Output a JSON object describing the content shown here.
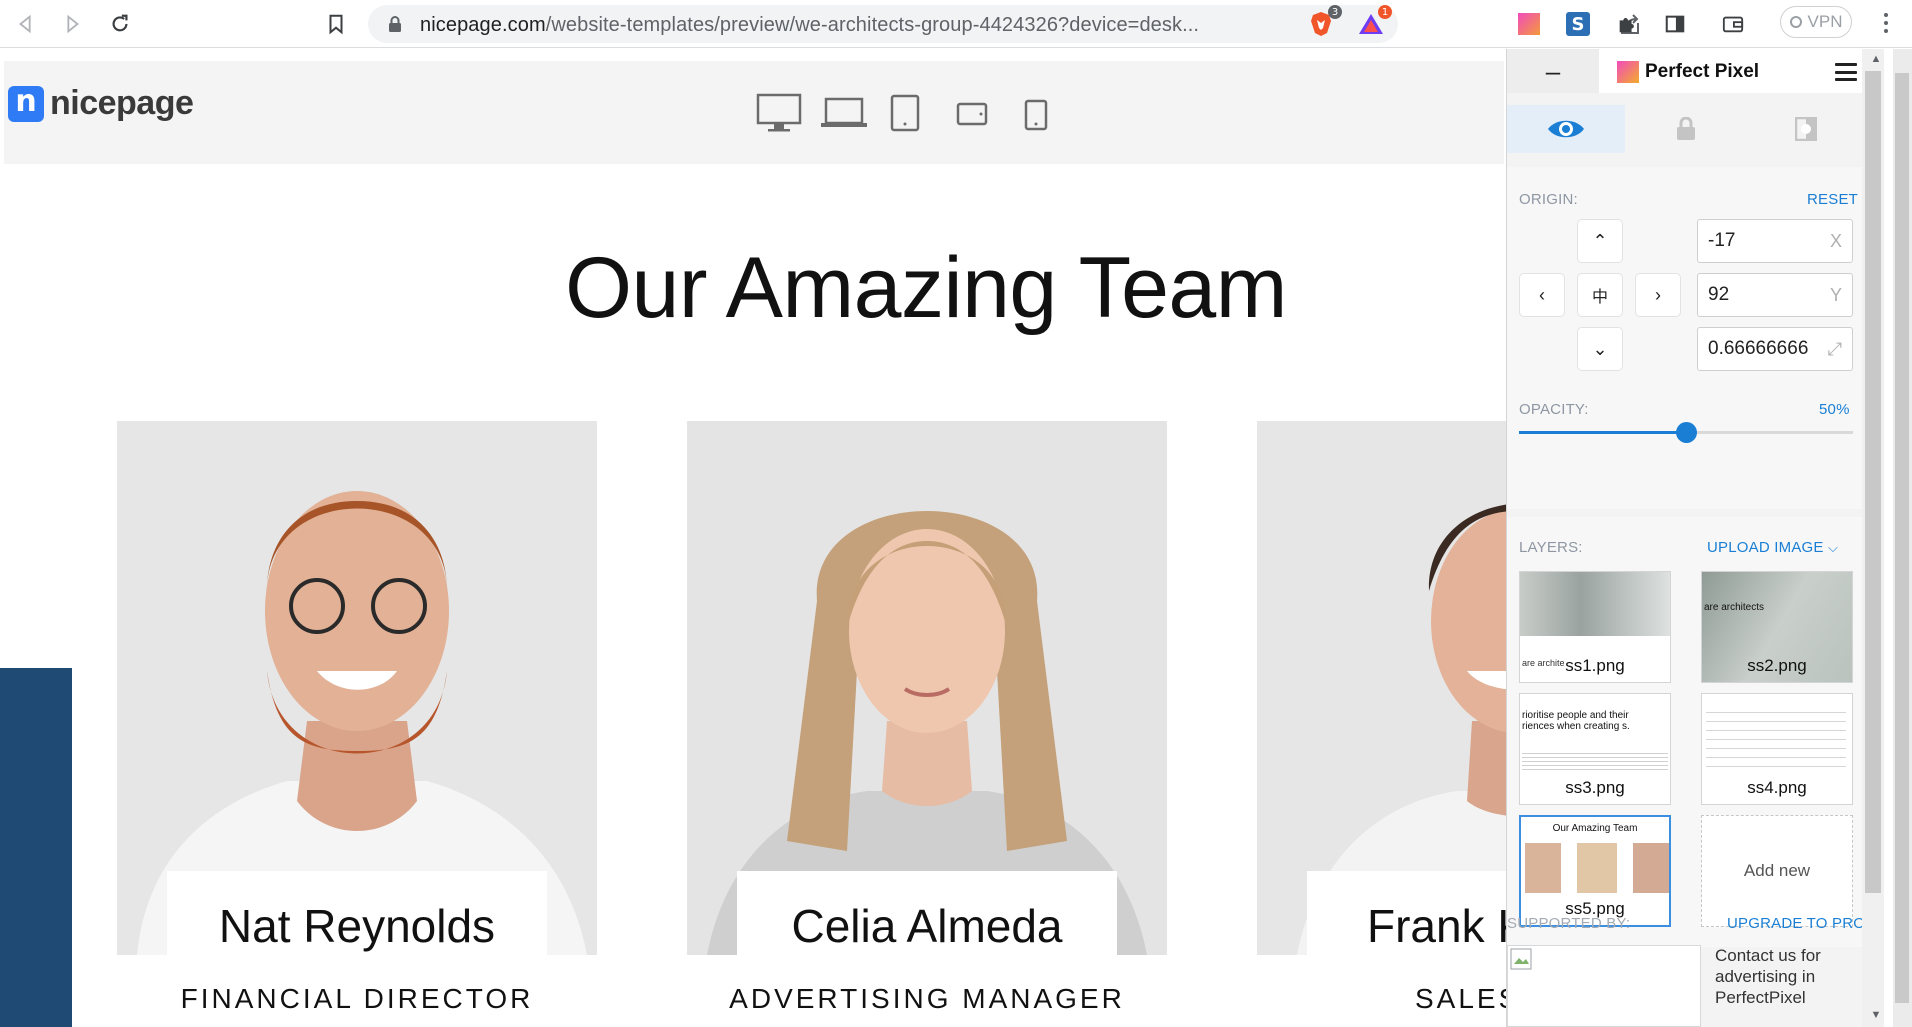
{
  "browser": {
    "url_host": "nicepage.com",
    "url_path": "/website-templates/preview/we-architects-group-4424326?device=desk...",
    "brave_badge": "3",
    "alert_badge": "1",
    "vpn_label": "VPN"
  },
  "site": {
    "logo_text": "nicepage",
    "logo_mark": "n",
    "title": "Our Amazing Team",
    "members": [
      {
        "name": "Nat Reynolds",
        "role": "FINANCIAL DIRECTOR"
      },
      {
        "name": "Celia Almeda",
        "role": "ADVERTISING MANAGER"
      },
      {
        "name": "Frank K",
        "role": "SALES MA"
      }
    ],
    "devices": [
      "desktop-icon",
      "laptop-icon",
      "tablet-icon",
      "tablet-landscape-icon",
      "phone-icon"
    ]
  },
  "perfect_pixel": {
    "minimize": "–",
    "title": "Perfect Pixel",
    "origin_label": "ORIGIN:",
    "reset_label": "RESET",
    "x_value": "-17",
    "x_unit": "X",
    "y_value": "92",
    "y_unit": "Y",
    "scale_value": "0.66666666",
    "opacity_label": "OPACITY:",
    "opacity_value": "50%",
    "opacity_fraction": 0.5,
    "layers_label": "LAYERS:",
    "upload_label": "UPLOAD IMAGE",
    "layers": [
      {
        "name": "ss1.png",
        "thumb_text": "are archite"
      },
      {
        "name": "ss2.png",
        "thumb_text": "are architects"
      },
      {
        "name": "ss3.png",
        "thumb_text": "rioritise people and their riences when creating s."
      },
      {
        "name": "ss4.png",
        "thumb_text": ""
      },
      {
        "name": "ss5.png",
        "thumb_text": "Our Amazing Team"
      }
    ],
    "add_new_label": "Add new",
    "supported_label": "SUPPORTED BY:",
    "upgrade_label": "UPGRADE TO PRO",
    "ad_text": "Contact us for advertising in PerfectPixel"
  },
  "colors": {
    "accent": "#1a7fd4",
    "nicepage_blue": "#2f7bf5",
    "strip_blue": "#1f4a73"
  }
}
